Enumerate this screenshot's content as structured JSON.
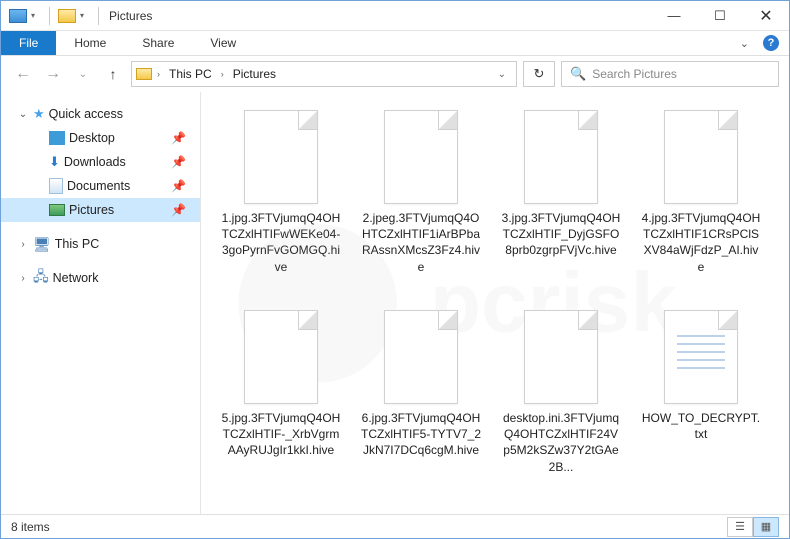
{
  "title_folder": "Pictures",
  "ribbon": {
    "file": "File",
    "home": "Home",
    "share": "Share",
    "view": "View"
  },
  "breadcrumb": {
    "root": "This PC",
    "leaf": "Pictures"
  },
  "search": {
    "placeholder": "Search Pictures"
  },
  "sidebar": {
    "quick_access": "Quick access",
    "items": [
      {
        "label": "Desktop"
      },
      {
        "label": "Downloads"
      },
      {
        "label": "Documents"
      },
      {
        "label": "Pictures"
      }
    ],
    "this_pc": "This PC",
    "network": "Network"
  },
  "files": [
    {
      "name": "1.jpg.3FTVjumqQ4OHTCZxlHTIFwWEKe04-3goPyrnFvGOMGQ.hive",
      "type": "blank"
    },
    {
      "name": "2.jpeg.3FTVjumqQ4OHTCZxlHTIF1iArBPbaRAssnXMcsZ3Fz4.hive",
      "type": "blank"
    },
    {
      "name": "3.jpg.3FTVjumqQ4OHTCZxlHTIF_DyjGSFO8prb0zgrpFVjVc.hive",
      "type": "blank"
    },
    {
      "name": "4.jpg.3FTVjumqQ4OHTCZxlHTIF1CRsPClSXV84aWjFdzP_AI.hive",
      "type": "blank"
    },
    {
      "name": "5.jpg.3FTVjumqQ4OHTCZxlHTIF-_XrbVgrmAAyRUJgIr1kkI.hive",
      "type": "blank"
    },
    {
      "name": "6.jpg.3FTVjumqQ4OHTCZxlHTIF5-TYTV7_2JkN7I7DCq6cgM.hive",
      "type": "blank"
    },
    {
      "name": "desktop.ini.3FTVjumqQ4OHTCZxlHTIF24Vp5M2kSZw37Y2tGAe2B...",
      "type": "blank"
    },
    {
      "name": "HOW_TO_DECRYPT.txt",
      "type": "txt"
    }
  ],
  "status": {
    "count": "8 items"
  }
}
